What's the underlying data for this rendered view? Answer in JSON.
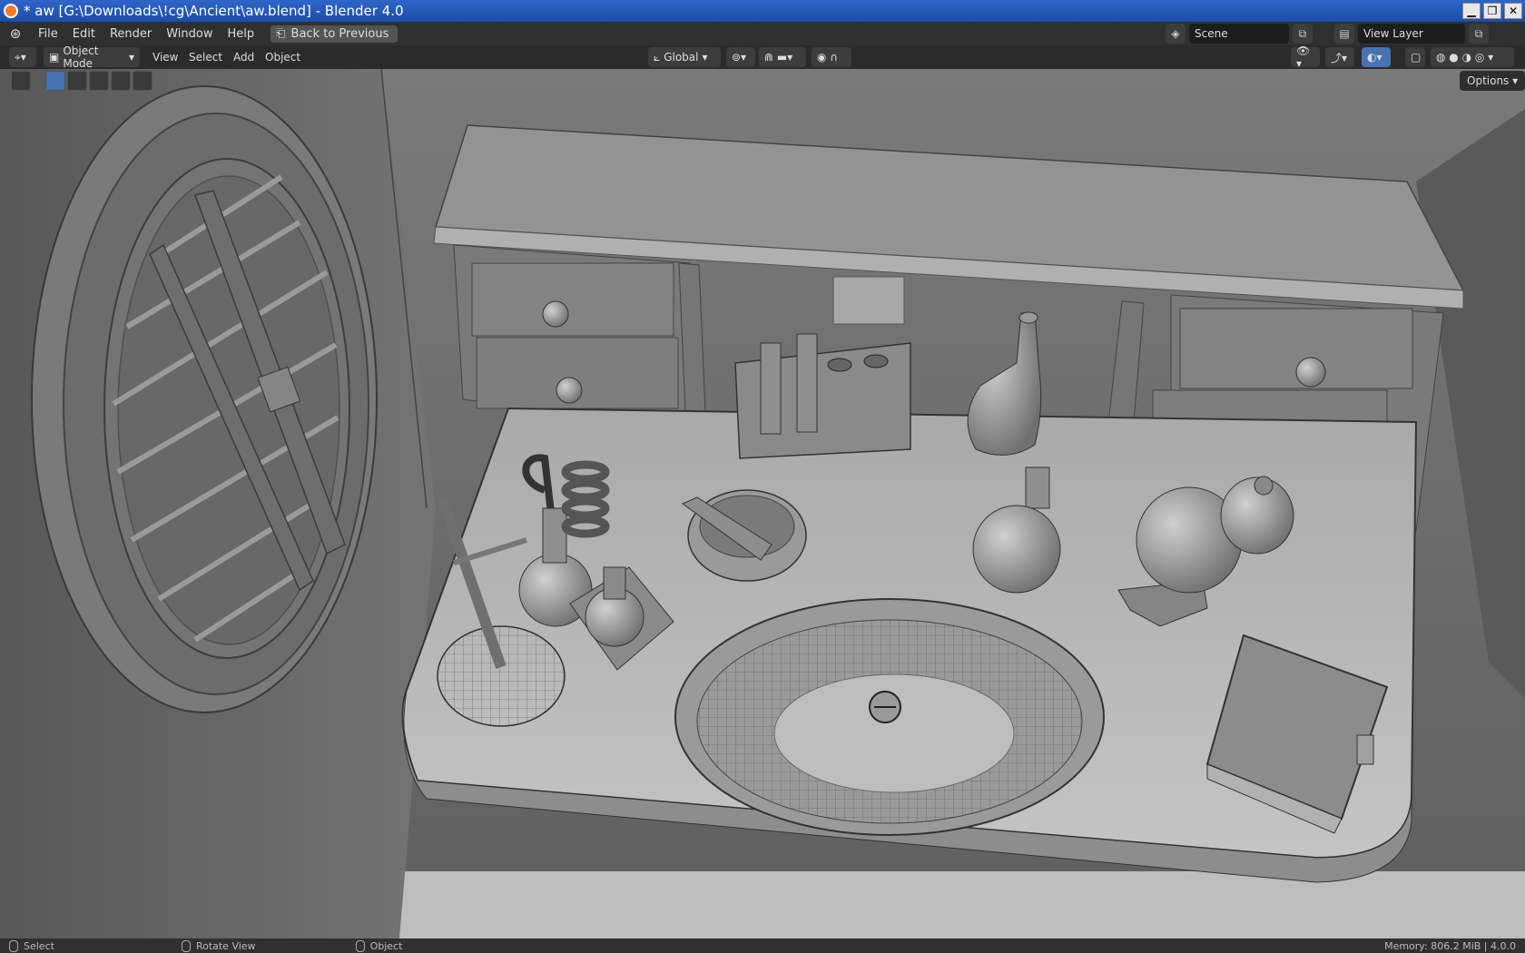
{
  "window": {
    "title": "* aw [G:\\Downloads\\!cg\\Ancient\\aw.blend] - Blender 4.0",
    "buttons": [
      "▁",
      "❐",
      "✕"
    ]
  },
  "menu": {
    "items": [
      "File",
      "Edit",
      "Render",
      "Window",
      "Help"
    ],
    "back_label": "Back to Previous",
    "scene": "Scene",
    "view_layer": "View Layer"
  },
  "header": {
    "mode": "Object Mode",
    "view": "View",
    "select": "Select",
    "add": "Add",
    "object": "Object",
    "orientation": "Global"
  },
  "viewport": {
    "options_label": "Options"
  },
  "status": {
    "select": "Select",
    "rotate": "Rotate View",
    "object": "Object",
    "memory": "Memory: 806.2 MiB | 4.0.0"
  },
  "colors": {
    "accent": "#4772b3",
    "titlebar": "#2f66c9"
  }
}
